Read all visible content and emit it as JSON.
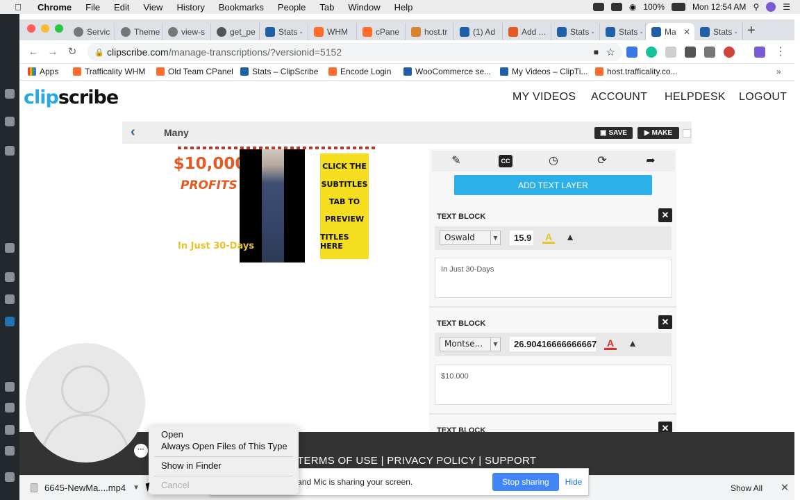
{
  "menubar": {
    "app": "Chrome",
    "items": [
      "File",
      "Edit",
      "View",
      "History",
      "Bookmarks",
      "People",
      "Tab",
      "Window",
      "Help"
    ],
    "battery": "100%",
    "clock": "Mon 12:54 AM"
  },
  "tabs": [
    {
      "label": "Servic"
    },
    {
      "label": "Theme"
    },
    {
      "label": "view-s"
    },
    {
      "label": "get_pe"
    },
    {
      "label": "Stats -"
    },
    {
      "label": "WHM"
    },
    {
      "label": "cPane"
    },
    {
      "label": "host.tr"
    },
    {
      "label": "(1) Ad"
    },
    {
      "label": "Add ..."
    },
    {
      "label": "Stats -"
    },
    {
      "label": "Stats -"
    },
    {
      "label": "Ma"
    },
    {
      "label": "Stats -"
    }
  ],
  "address": {
    "domain": "clipscribe.com",
    "path": "/manage-transcriptions/?versionid=5152"
  },
  "bookmarks": [
    "Apps",
    "Trafficality WHM",
    "Old Team CPanel",
    "Stats – ClipScribe",
    "Encode Login",
    "WooCommerce se...",
    "My Videos – ClipTi...",
    "host.trafficality.co..."
  ],
  "site": {
    "logo_a": "clip",
    "logo_b": "scribe",
    "nav": [
      "MY VIDEOS",
      "ACCOUNT",
      "HELPDESK",
      "LOGOUT"
    ]
  },
  "editor": {
    "project_name": "Many",
    "save_label": "SAVE",
    "make_label": "MAKE",
    "add_text_label": "ADD TEXT LAYER"
  },
  "preview": {
    "money": "$10,000",
    "profits": "PROFITS",
    "days": "In Just 30-Days",
    "yellow_lines": [
      "CLICK THE",
      "SUBTITLES",
      "TAB TO",
      "PREVIEW",
      "TITLES HERE"
    ]
  },
  "text_blocks": [
    {
      "label": "TEXT BLOCK",
      "font": "Oswald",
      "size": "15.9",
      "text": "In Just 30-Days"
    },
    {
      "label": "TEXT BLOCK",
      "font": "Montse...",
      "size": "26.90416666666667",
      "text": "$10.000"
    },
    {
      "label": "TEXT BLOCK"
    }
  ],
  "footer": {
    "links": "TERMS OF USE | PRIVACY POLICY | SUPPORT"
  },
  "context_menu": {
    "open": "Open",
    "always_open": "Always Open Files of This Type",
    "show_in_finder": "Show in Finder",
    "cancel": "Cancel"
  },
  "download": {
    "filename": "6645-NewMa....mp4",
    "show_all": "Show All"
  },
  "share_banner": {
    "text": "der: Screen, Webcam and Mic is sharing your screen.",
    "stop": "Stop sharing",
    "hide": "Hide"
  },
  "colors": {
    "brand_blue": "#29a9e1",
    "orange": "#e45a23",
    "yellow": "#f5de1f",
    "button_blue": "#4285f4"
  }
}
